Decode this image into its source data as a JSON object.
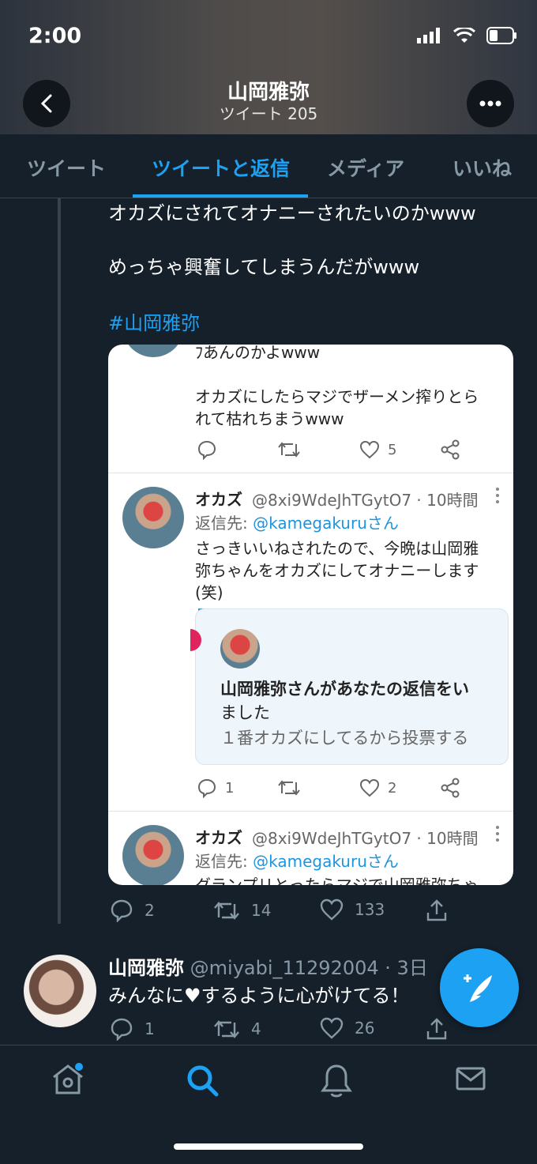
{
  "status": {
    "time": "2:00"
  },
  "header": {
    "title": "山岡雅弥",
    "subtitle": "ツイート 205"
  },
  "tabs": [
    {
      "label": "ツイート"
    },
    {
      "label": "ツイートと返信"
    },
    {
      "label": "メディア"
    },
    {
      "label": "いいね"
    }
  ],
  "tweet1": {
    "line1": "オカズにされてオナニーされたいのかwww",
    "line2": "めっちゃ興奮してしまうんだがwww",
    "hashtag": "#山岡雅弥",
    "image": {
      "top_line": "ﾌあんのかよwww",
      "top_text1": "オカズにしたらマジでザーメン搾りとら",
      "top_text2": "れて枯れちまうwww",
      "top_like_count": "5",
      "reply1": {
        "name": "オカズ",
        "handle": "@8xi9WdeJhTGytO7 · 10時間",
        "reply_to_prefix": "返信先: ",
        "reply_to": "@kamegakuruさん",
        "text1": "さっきいいねされたので、今晩は山岡雅",
        "text2": "弥ちゃんをオカズにしてオナニーします",
        "text3": "(笑)",
        "quote1": "山岡雅弥さんがあなたの返信をい",
        "quote2": "ました",
        "quote3": "１番オカズにしてるから投票する",
        "reply_count": "1",
        "like_count": "2"
      },
      "reply2": {
        "name": "オカズ",
        "handle": "@8xi9WdeJhTGytO7 · 10時間",
        "reply_to_prefix": "返信先: ",
        "reply_to": "@kamegakuruさん",
        "text1": "グランプリとったらマジで山岡雅弥ちゃ"
      }
    },
    "replies": "2",
    "retweets": "14",
    "likes": "133"
  },
  "tweet2": {
    "name": "山岡雅弥",
    "meta": "@miyabi_11292004 · 3日",
    "text": "みんなに♥するように心がけてる！",
    "replies": "1",
    "retweets": "4",
    "likes": "26"
  },
  "colors": {
    "accent": "#1da1f2",
    "background": "#15202b",
    "muted": "#8899a6"
  },
  "icons": [
    "back-icon",
    "more-icon",
    "home-icon",
    "search-icon",
    "notifications-icon",
    "messages-icon",
    "compose-icon"
  ]
}
